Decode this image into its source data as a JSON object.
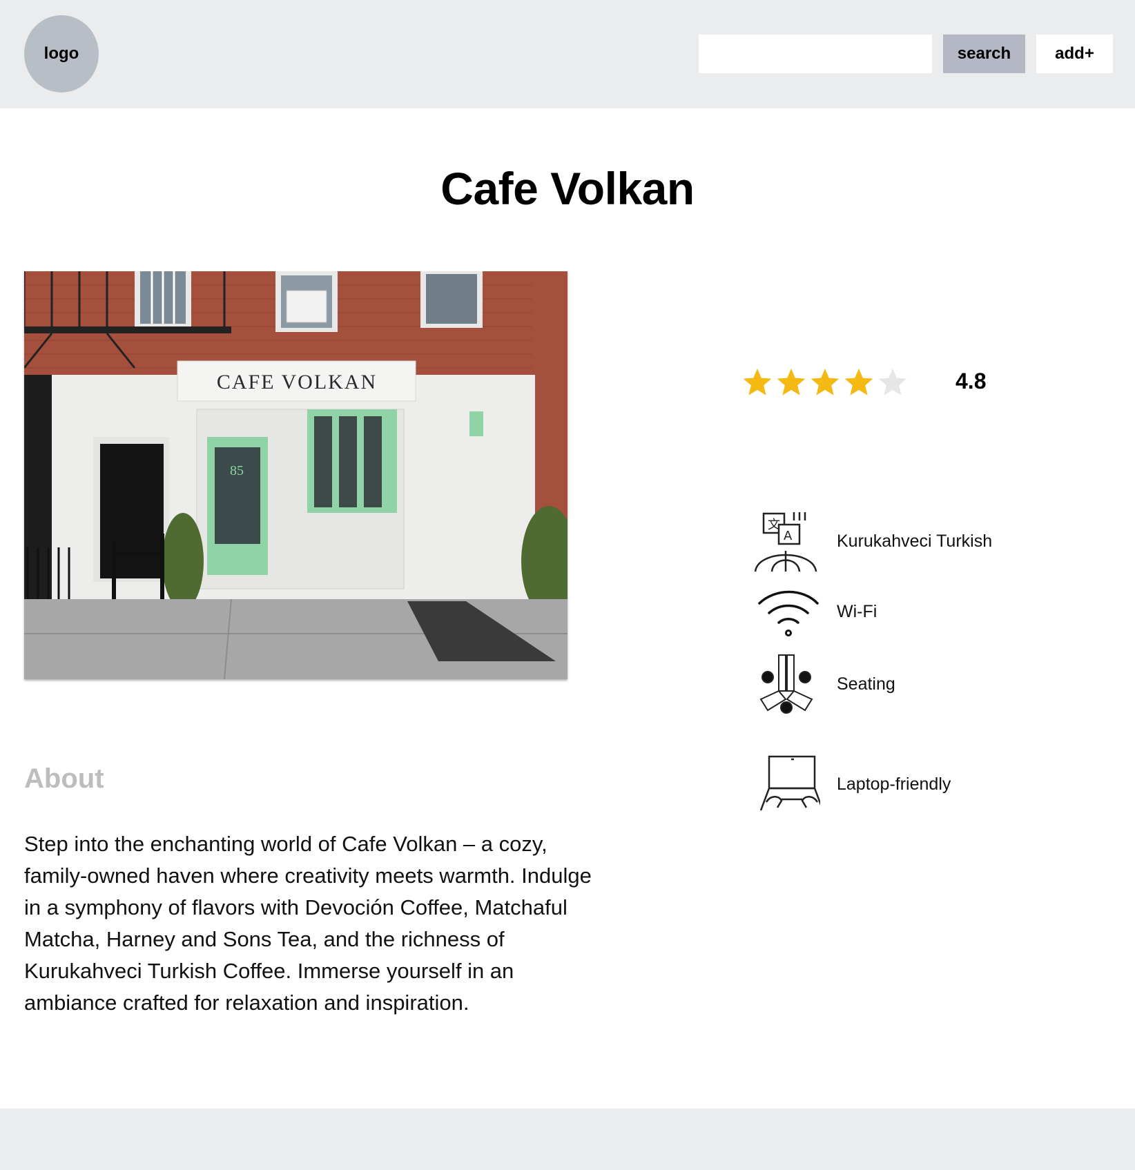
{
  "header": {
    "logo_text": "logo",
    "search": {
      "value": "",
      "placeholder": ""
    },
    "search_label": "search",
    "add_label": "add+"
  },
  "cafe": {
    "name": "Cafe Volkan",
    "photo": {
      "sign_text": "CAFE VOLKAN",
      "door_number": "85"
    },
    "rating": {
      "value": "4.8",
      "stars_filled": 4,
      "stars_total": 5,
      "star_color": "#f5b914"
    },
    "about": {
      "heading": "About",
      "text": "Step into the enchanting world of Cafe Volkan – a cozy, family-owned haven where creativity meets warmth. Indulge in a symphony of flavors with Devoción Coffee, Matchaful Matcha, Harney and Sons Tea, and the richness of Kurukahveci Turkish Coffee. Immerse yourself in an ambiance crafted for relaxation and inspiration."
    },
    "amenities": [
      {
        "icon": "translate-globe-icon",
        "label": "Kurukahveci Turkish"
      },
      {
        "icon": "wifi-icon",
        "label": "Wi-Fi"
      },
      {
        "icon": "seating-icon",
        "label": "Seating"
      },
      {
        "icon": "laptop-icon",
        "label": "Laptop-friendly"
      }
    ]
  },
  "colors": {
    "header_bg": "#ebecee",
    "logo_bg": "#b8bec6",
    "search_button_bg": "#b4b7c4",
    "about_heading": "#bdbdbd",
    "door_green": "#8fd3a6"
  }
}
